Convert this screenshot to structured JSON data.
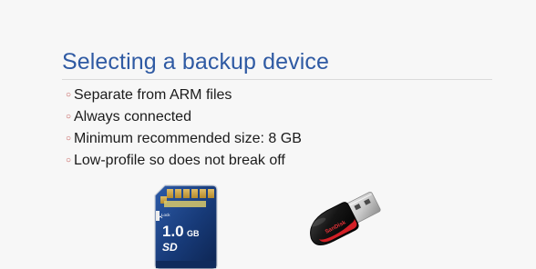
{
  "slide": {
    "title": "Selecting a backup device",
    "bullets": [
      "Separate from ARM files",
      "Always connected",
      "Minimum recommended size: 8 GB",
      "Low-profile so does not break off"
    ]
  },
  "images": {
    "sd_card": {
      "icon": "sd-card-icon",
      "lock_label": "Lock",
      "capacity": "1.0",
      "unit": "GB",
      "logo": "SD"
    },
    "usb_drive": {
      "icon": "usb-flash-drive-icon",
      "brand": "SanDisk"
    }
  },
  "colors": {
    "title": "#2f5aa3",
    "bullet_marker": "#c0504d",
    "text": "#1b1b1b",
    "sd_card_body": "#173a78",
    "usb_body": "#111111",
    "usb_accent": "#d31f26"
  }
}
